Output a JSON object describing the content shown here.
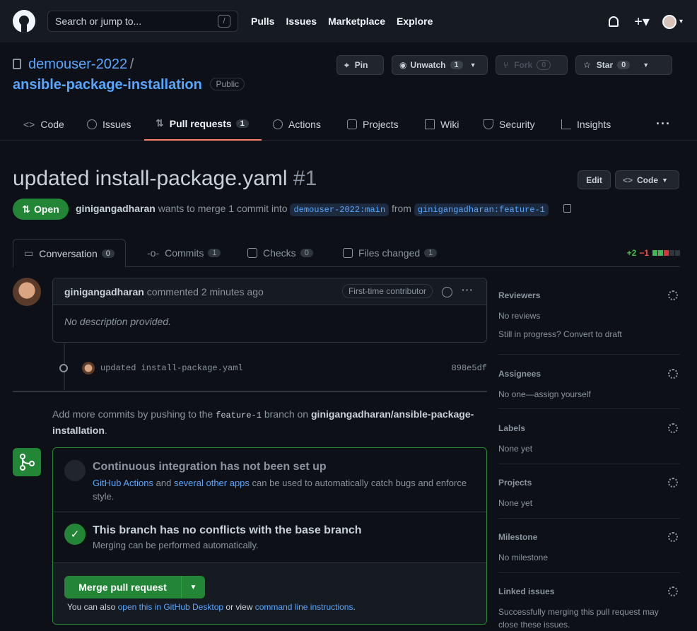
{
  "header": {
    "search_placeholder": "Search or jump to...",
    "slash_key": "/",
    "nav": [
      "Pulls",
      "Issues",
      "Marketplace",
      "Explore"
    ]
  },
  "repo": {
    "owner": "demouser-2022",
    "separator": "/",
    "name": "ansible-package-installation",
    "visibility": "Public"
  },
  "repo_actions": {
    "pin": "Pin",
    "unwatch": "Unwatch",
    "unwatch_count": "1",
    "fork": "Fork",
    "fork_count": "0",
    "star": "Star",
    "star_count": "0"
  },
  "repo_tabs": [
    {
      "label": "Code"
    },
    {
      "label": "Issues"
    },
    {
      "label": "Pull requests",
      "count": "1"
    },
    {
      "label": "Actions"
    },
    {
      "label": "Projects"
    },
    {
      "label": "Wiki"
    },
    {
      "label": "Security"
    },
    {
      "label": "Insights"
    }
  ],
  "pr": {
    "title": "updated install-package.yaml",
    "number": "#1",
    "edit": "Edit",
    "code": "Code",
    "state": "Open",
    "author": "ginigangadharan",
    "meta_text": "wants to merge 1 commit into",
    "base": "demouser-2022:main",
    "from": "from",
    "head": "ginigangadharan:feature-1"
  },
  "pr_tabs": [
    {
      "label": "Conversation",
      "count": "0"
    },
    {
      "label": "Commits",
      "count": "1"
    },
    {
      "label": "Checks",
      "count": "0"
    },
    {
      "label": "Files changed",
      "count": "1"
    }
  ],
  "diffstat": {
    "additions": "+2",
    "deletions": "−1"
  },
  "comment": {
    "author": "ginigangadharan",
    "action": "commented 2 minutes ago",
    "badge": "First-time contributor",
    "body": "No description provided."
  },
  "commit": {
    "message": "updated install-package.yaml",
    "sha": "898e5df"
  },
  "add_more": {
    "pre": "Add more commits by pushing to the",
    "branch": "feature-1",
    "mid": "branch on",
    "repo": "ginigangadharan/ansible-package-installation",
    "end": "."
  },
  "merge": {
    "ci_title": "Continuous integration has not been set up",
    "ci_link1": "GitHub Actions",
    "ci_and": "and",
    "ci_link2": "several other apps",
    "ci_rest": "can be used to automatically catch bugs and enforce style.",
    "ok_title": "This branch has no conflicts with the base branch",
    "ok_sub": "Merging can be performed automatically.",
    "button": "Merge pull request",
    "note_pre": "You can also",
    "note_link1": "open this in GitHub Desktop",
    "note_mid": "or view",
    "note_link2": "command line instructions",
    "note_end": "."
  },
  "sidebar": {
    "reviewers": {
      "title": "Reviewers",
      "line1": "No reviews",
      "line2": "Still in progress? Convert to draft"
    },
    "assignees": {
      "title": "Assignees",
      "value": "No one—assign yourself"
    },
    "labels": {
      "title": "Labels",
      "value": "None yet"
    },
    "projects": {
      "title": "Projects",
      "value": "None yet"
    },
    "milestone": {
      "title": "Milestone",
      "value": "No milestone"
    },
    "linked": {
      "title": "Linked issues",
      "value": "Successfully merging this pull request may close these issues."
    }
  },
  "colors": {
    "accent": "#58a6ff",
    "success": "#238636",
    "tab_underline": "#f78166"
  }
}
